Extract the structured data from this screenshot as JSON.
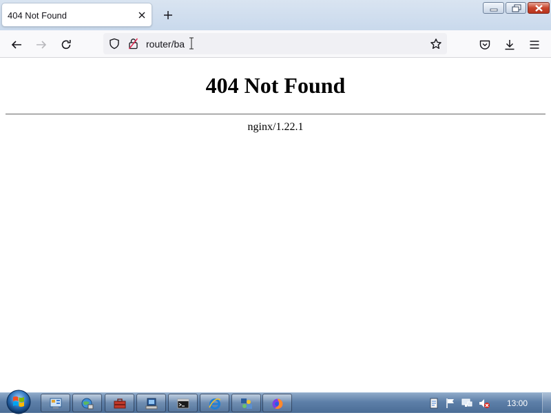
{
  "tab": {
    "title": "404 Not Found"
  },
  "toolbar": {
    "url": "router/ba"
  },
  "page": {
    "heading": "404 Not Found",
    "server": "nginx/1.22.1"
  },
  "taskbar": {
    "clock": "13:00",
    "apps": [
      "control-panel",
      "network",
      "toolbox",
      "computer",
      "command-prompt",
      "internet-explorer",
      "network-users",
      "firefox"
    ]
  },
  "colors": {
    "titlebar": "#d4e0ef",
    "tab_bg": "#ffffff",
    "toolbar_bg": "#f9f9fb",
    "urlbar_bg": "#f0f0f4",
    "taskbar": "#5d7fa8",
    "close_button": "#c7452d"
  }
}
